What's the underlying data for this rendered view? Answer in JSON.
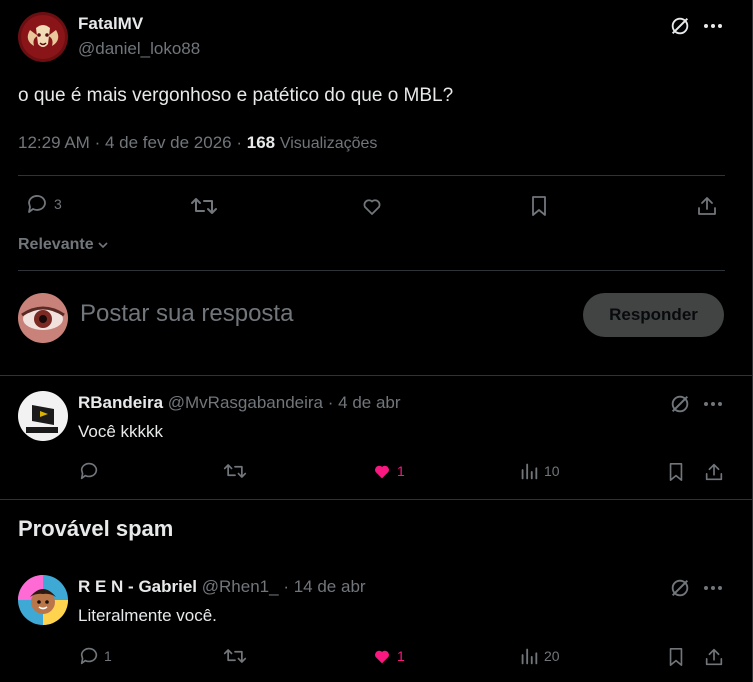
{
  "post": {
    "author_name": "FatalMV",
    "author_handle": "@daniel_loko88",
    "text": "o que é mais vergonhoso e patético do que o MBL?",
    "time": "12:29 AM",
    "date": "4 de fev de 2026",
    "views_count": "168",
    "views_label": "Visualizações",
    "replies_count": "3"
  },
  "sort": {
    "label": "Relevante"
  },
  "composer": {
    "placeholder": "Postar sua resposta",
    "button_label": "Responder"
  },
  "replies": [
    {
      "author_name": "RBandeira",
      "author_handle": "@MvRasgabandeira",
      "date": "4 de abr",
      "text": "Você kkkkk",
      "reply_count": "",
      "like_count": "1",
      "view_count": "10"
    },
    {
      "author_name": "R E N - Gabriel",
      "author_handle": "@Rhen1_",
      "date": "14 de abr",
      "text": "Literalmente você.",
      "reply_count": "1",
      "like_count": "1",
      "view_count": "20"
    }
  ],
  "spam_section": {
    "title": "Provável spam"
  },
  "colors": {
    "background": "#000000",
    "text": "#e7e9ea",
    "muted": "#71767b",
    "like": "#f91880",
    "divider": "#2f3336"
  }
}
